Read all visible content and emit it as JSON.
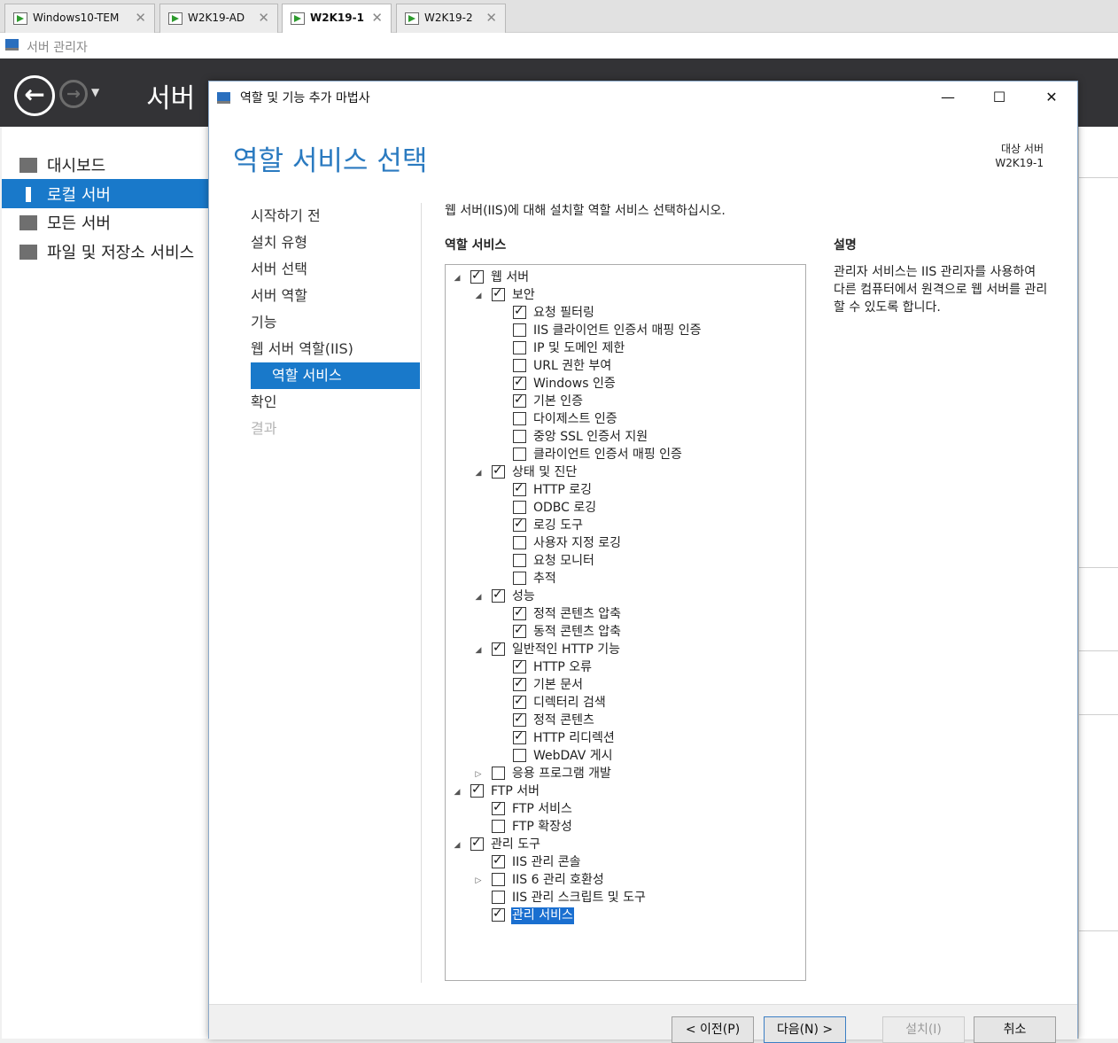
{
  "vm_tabs": [
    {
      "label": "Windows10-TEM"
    },
    {
      "label": "W2K19-AD"
    },
    {
      "label": "W2K19-1"
    },
    {
      "label": "W2K19-2"
    }
  ],
  "server_manager": {
    "title": "서버 관리자",
    "header_text": "서버",
    "nav": [
      {
        "label": "대시보드"
      },
      {
        "label": "로컬 서버"
      },
      {
        "label": "모든 서버"
      },
      {
        "label": "파일 및 저장소 서비스"
      }
    ]
  },
  "dialog": {
    "title": "역할 및 기능 추가 마법사",
    "page_title": "역할 서비스 선택",
    "target_label": "대상 서버",
    "target_server": "W2K19-1",
    "steps": [
      {
        "label": "시작하기 전"
      },
      {
        "label": "설치 유형"
      },
      {
        "label": "서버 선택"
      },
      {
        "label": "서버 역할"
      },
      {
        "label": "기능"
      },
      {
        "label": "웹 서버 역할(IIS)"
      },
      {
        "label": "역할 서비스"
      },
      {
        "label": "확인"
      },
      {
        "label": "결과"
      }
    ],
    "instruction": "웹 서버(IIS)에 대해 설치할 역할 서비스 선택하십시오.",
    "section_label": "역할 서비스",
    "description_label": "설명",
    "description_text": "관리자 서비스는 IIS 관리자를 사용하여 다른 컴퓨터에서 원격으로 웹 서버를 관리할 수 있도록 합니다.",
    "tree": [
      {
        "label": "웹 서버",
        "level": 0,
        "expander": "expanded",
        "checked": true
      },
      {
        "label": "보안",
        "level": 1,
        "expander": "expanded",
        "checked": true
      },
      {
        "label": "요청 필터링",
        "level": 2,
        "expander": "none",
        "checked": true
      },
      {
        "label": "IIS 클라이언트 인증서 매핑 인증",
        "level": 2,
        "expander": "none",
        "checked": false
      },
      {
        "label": "IP 및 도메인 제한",
        "level": 2,
        "expander": "none",
        "checked": false
      },
      {
        "label": "URL 권한 부여",
        "level": 2,
        "expander": "none",
        "checked": false
      },
      {
        "label": "Windows 인증",
        "level": 2,
        "expander": "none",
        "checked": true
      },
      {
        "label": "기본 인증",
        "level": 2,
        "expander": "none",
        "checked": true
      },
      {
        "label": "다이제스트 인증",
        "level": 2,
        "expander": "none",
        "checked": false
      },
      {
        "label": "중앙 SSL 인증서 지원",
        "level": 2,
        "expander": "none",
        "checked": false
      },
      {
        "label": "클라이언트 인증서 매핑 인증",
        "level": 2,
        "expander": "none",
        "checked": false
      },
      {
        "label": "상태 및 진단",
        "level": 1,
        "expander": "expanded",
        "checked": true
      },
      {
        "label": "HTTP 로깅",
        "level": 2,
        "expander": "none",
        "checked": true
      },
      {
        "label": "ODBC 로깅",
        "level": 2,
        "expander": "none",
        "checked": false
      },
      {
        "label": "로깅 도구",
        "level": 2,
        "expander": "none",
        "checked": true
      },
      {
        "label": "사용자 지정 로깅",
        "level": 2,
        "expander": "none",
        "checked": false
      },
      {
        "label": "요청 모니터",
        "level": 2,
        "expander": "none",
        "checked": false
      },
      {
        "label": "추적",
        "level": 2,
        "expander": "none",
        "checked": false
      },
      {
        "label": "성능",
        "level": 1,
        "expander": "expanded",
        "checked": true
      },
      {
        "label": "정적 콘텐츠 압축",
        "level": 2,
        "expander": "none",
        "checked": true
      },
      {
        "label": "동적 콘텐츠 압축",
        "level": 2,
        "expander": "none",
        "checked": true
      },
      {
        "label": "일반적인 HTTP 기능",
        "level": 1,
        "expander": "expanded",
        "checked": true
      },
      {
        "label": "HTTP 오류",
        "level": 2,
        "expander": "none",
        "checked": true
      },
      {
        "label": "기본 문서",
        "level": 2,
        "expander": "none",
        "checked": true
      },
      {
        "label": "디렉터리 검색",
        "level": 2,
        "expander": "none",
        "checked": true
      },
      {
        "label": "정적 콘텐츠",
        "level": 2,
        "expander": "none",
        "checked": true
      },
      {
        "label": "HTTP 리디렉션",
        "level": 2,
        "expander": "none",
        "checked": true
      },
      {
        "label": "WebDAV 게시",
        "level": 2,
        "expander": "none",
        "checked": false
      },
      {
        "label": "응용 프로그램 개발",
        "level": 1,
        "expander": "collapsed",
        "checked": false
      },
      {
        "label": "FTP 서버",
        "level": 0,
        "expander": "expanded",
        "checked": true
      },
      {
        "label": "FTP 서비스",
        "level": 1,
        "expander": "none",
        "checked": true
      },
      {
        "label": "FTP 확장성",
        "level": 1,
        "expander": "none",
        "checked": false
      },
      {
        "label": "관리 도구",
        "level": 0,
        "expander": "expanded",
        "checked": true
      },
      {
        "label": "IIS 관리 콘솔",
        "level": 1,
        "expander": "none",
        "checked": true
      },
      {
        "label": "IIS 6 관리 호환성",
        "level": 1,
        "expander": "collapsed",
        "checked": false
      },
      {
        "label": "IIS 관리 스크립트 및 도구",
        "level": 1,
        "expander": "none",
        "checked": false
      },
      {
        "label": "관리 서비스",
        "level": 1,
        "expander": "none",
        "checked": true,
        "selected": true
      }
    ],
    "buttons": {
      "prev": "< 이전(P)",
      "next": "다음(N) >",
      "install": "설치(I)",
      "cancel": "취소"
    }
  }
}
